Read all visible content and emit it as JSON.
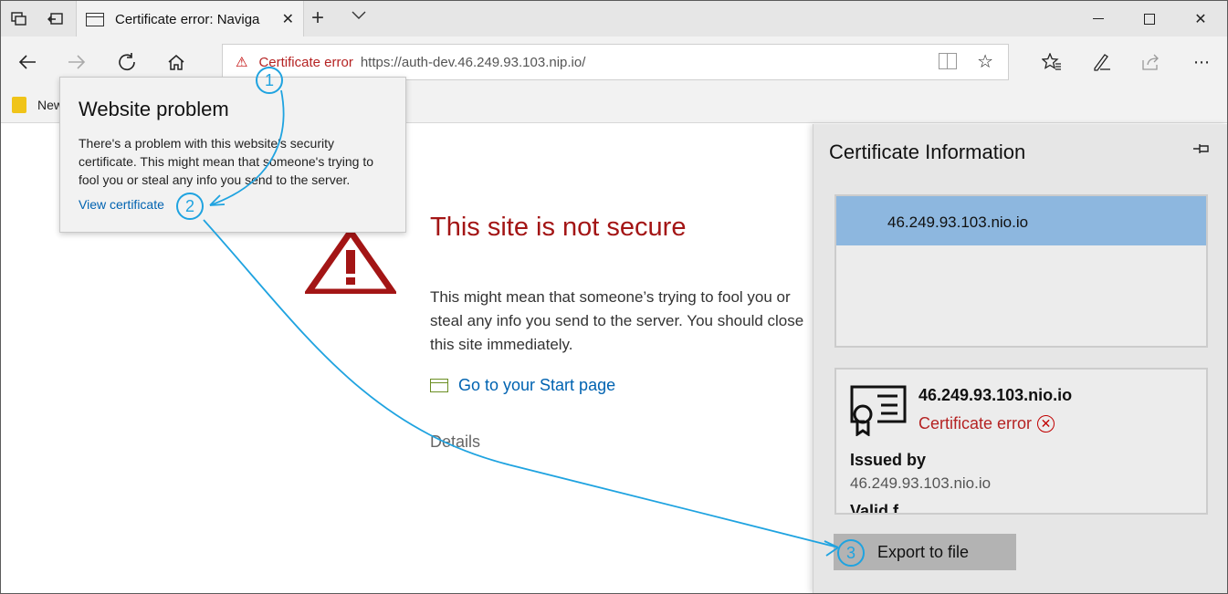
{
  "window": {
    "tab_title": "Certificate error: Naviga",
    "icons": [
      "tab-preview-icon",
      "set-aside-tabs-icon",
      "close-icon",
      "new-tab-icon",
      "chevron-down-icon",
      "minimize-icon",
      "maximize-icon",
      "window-close-icon"
    ]
  },
  "nav": {
    "cert_error_label": "Certificate error",
    "url": "https://auth-dev.46.249.93.103.nip.io/",
    "icons": [
      "back-icon",
      "forward-icon",
      "refresh-icon",
      "home-icon",
      "reading-view-icon",
      "favorite-star-icon",
      "favorites-hub-icon",
      "web-note-icon",
      "share-icon",
      "more-icon"
    ]
  },
  "favbar": {
    "folder_label": "New"
  },
  "flyout": {
    "title": "Website problem",
    "body": "There's a problem with this website's security certificate. This might mean that someone's trying to fool you or steal any info you send to the server.",
    "link": "View certificate"
  },
  "page": {
    "title": "This site is not secure",
    "body": "This might mean that someone’s trying to fool you or steal any info you send to the server. You should close this site immediately.",
    "start_link": "Go to your Start page",
    "details": "Details"
  },
  "cert_panel": {
    "title": "Certificate Information",
    "list_item": "46.249.93.103.nio.io",
    "name": "46.249.93.103.nio.io",
    "status": "Certificate error",
    "issued_by_label": "Issued by",
    "issued_by_value": "46.249.93.103.nio.io",
    "valid_label": "Valid f",
    "export_button": "Export to file"
  },
  "annotations": [
    "1",
    "2",
    "3"
  ],
  "colors": {
    "error_red": "#a31515",
    "link_blue": "#0063b1",
    "annotation_blue": "#1fa3e0",
    "selected_item": "#8db7df"
  }
}
